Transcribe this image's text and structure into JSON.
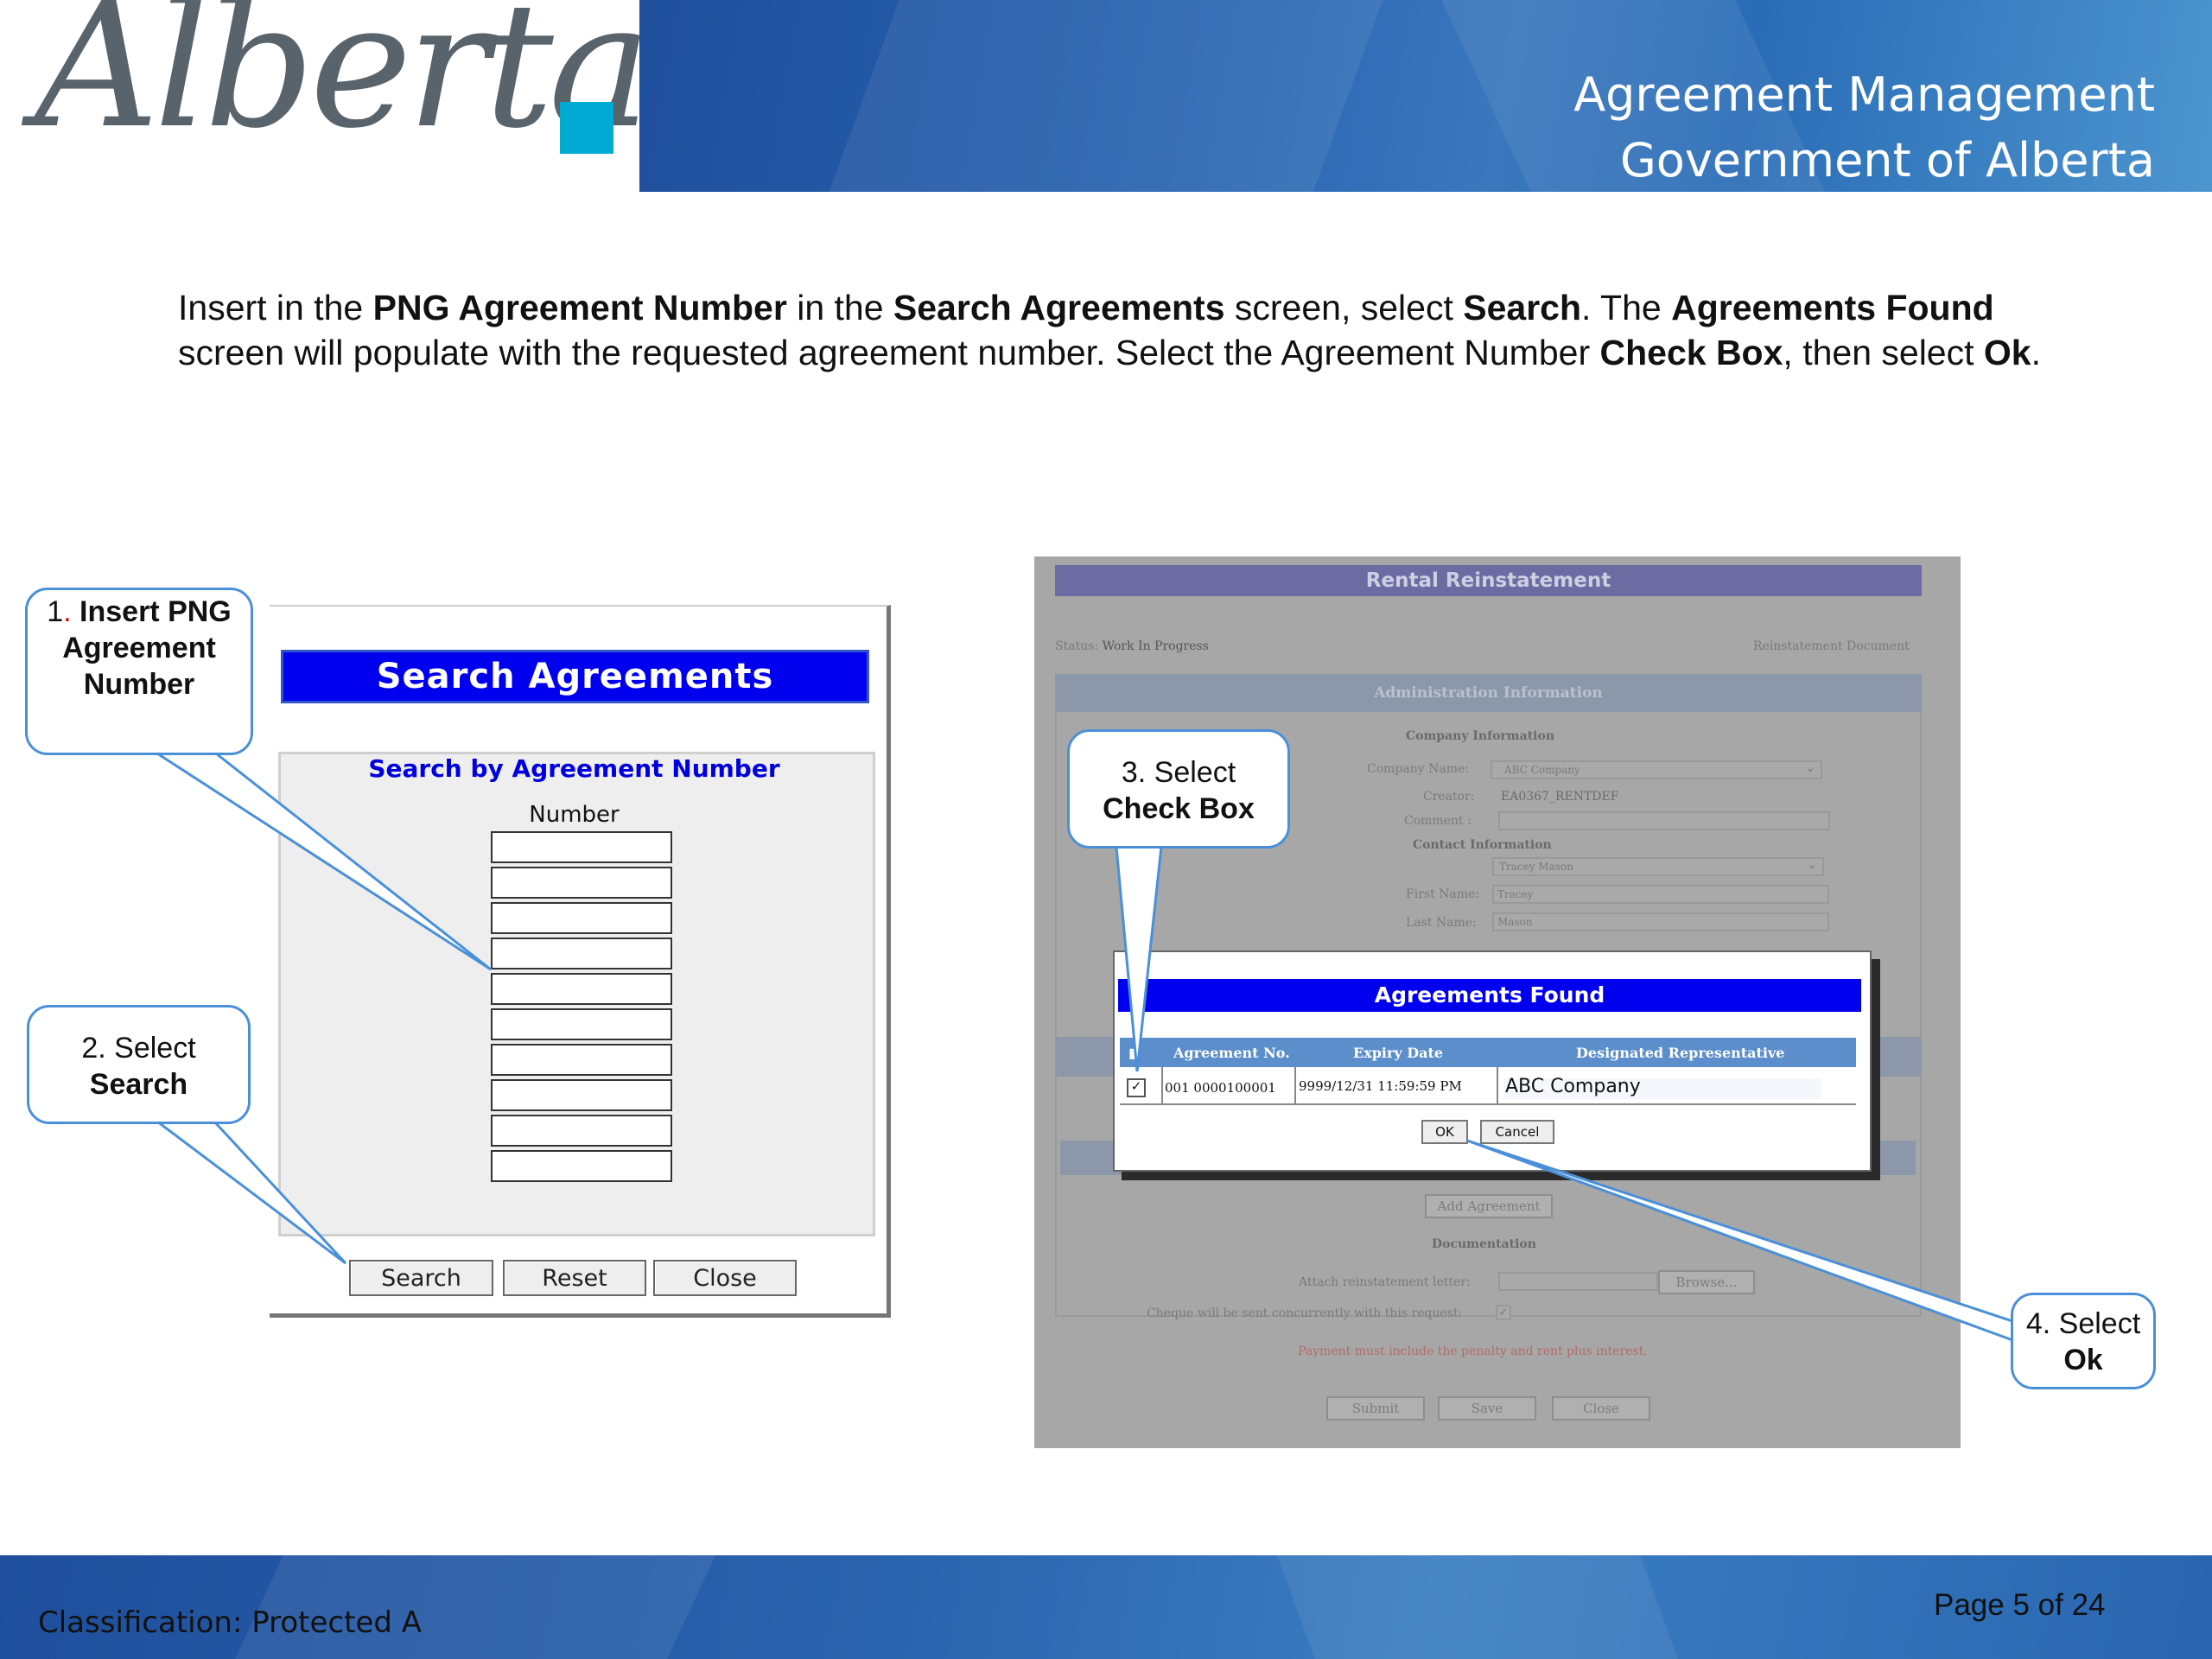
{
  "header": {
    "logo_text": "Alberta",
    "title_line1": "Agreement Management",
    "title_line2": "Government of Alberta",
    "colors": {
      "band": "#2660ad",
      "logo_accent": "#00aad2",
      "logo_text": "#59636b"
    }
  },
  "instruction": {
    "p1": "Insert in the ",
    "b1": "PNG Agreement Number",
    "p2": " in the ",
    "b2": "Search Agreements",
    "p3": " screen, select ",
    "b3": "Search",
    "p4": ".  The ",
    "b4": "Agreements Found",
    "p5": " screen will populate with the requested agreement number.  Select the Agreement Number ",
    "b5": "Check Box",
    "p6": ", then select ",
    "b6": "Ok",
    "p7": "."
  },
  "search_agreements": {
    "title": "Search Agreements",
    "subtitle": "Search by Agreement Number",
    "number_label": "Number",
    "buttons": {
      "search": "Search",
      "reset": "Reset",
      "close": "Close"
    }
  },
  "rental_reinstatement": {
    "title": "Rental Reinstatement",
    "status_label": "Status:",
    "status_value": "Work In Progress",
    "doc_label": "Reinstatement Document",
    "admin_header": "Administration Information",
    "company_info": "Company Information",
    "company_name_label": "Company Name:",
    "company_name_value": "ABC Company",
    "creator_label": "Creator:",
    "creator_value": "EA0367_RENTDEF",
    "comment_label": "Comment :",
    "contact_info": "Contact Information",
    "contact_value": "Tracey Mason",
    "first_name_label": "First Name:",
    "first_name_value": "Tracey",
    "last_name_label": "Last Name:",
    "last_name_value": "Mason",
    "add_agreement": "Add Agreement",
    "documentation": "Documentation",
    "attach_label": "Attach reinstatement letter:",
    "browse": "Browse...",
    "cheque_label": "Cheque will be sent concurrently with this request:",
    "payment_note": "Payment must include the penalty and rent plus interest.",
    "buttons": {
      "submit": "Submit",
      "save": "Save",
      "close": "Close"
    }
  },
  "agreements_found": {
    "title": "Agreements Found",
    "columns": [
      "Agreement No.",
      "Expiry Date",
      "Designated Representative"
    ],
    "row": {
      "agreement_no": "001 0000100001",
      "expiry_date": "9999/12/31 11:59:59 PM",
      "representative": "ABC Company",
      "checked": true
    },
    "buttons": {
      "ok": "OK",
      "cancel": "Cancel"
    }
  },
  "callouts": {
    "c1": {
      "num": "1",
      "text": "Insert PNG Agreement Number"
    },
    "c2": {
      "line1": "2. Select",
      "line2": "Search"
    },
    "c3": {
      "line1": "3. Select",
      "line2": "Check Box"
    },
    "c4": {
      "line1": "4. Select",
      "line2": "Ok"
    }
  },
  "footer": {
    "classification": "Classification: Protected A",
    "page": "Page 5 of 24"
  }
}
